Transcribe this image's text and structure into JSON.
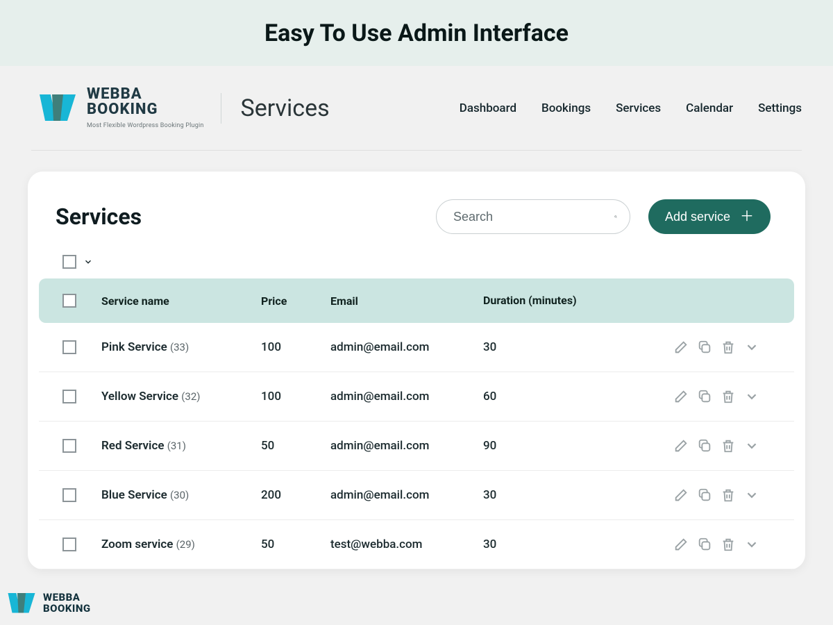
{
  "banner": {
    "title": "Easy To Use Admin Interface"
  },
  "brand": {
    "name1": "WEBBA",
    "name2": "BOOKING",
    "tagline": "Most Flexible Wordpress Booking Plugin"
  },
  "page_title": "Services",
  "nav": [
    "Dashboard",
    "Bookings",
    "Services",
    "Calendar",
    "Settings"
  ],
  "card": {
    "title": "Services",
    "search_placeholder": "Search",
    "add_button": "Add service"
  },
  "columns": {
    "name": "Service name",
    "price": "Price",
    "email": "Email",
    "duration": "Duration (minutes)"
  },
  "rows": [
    {
      "name": "Pink Service",
      "id": "(33)",
      "price": "100",
      "email": "admin@email.com",
      "duration": "30"
    },
    {
      "name": "Yellow Service",
      "id": "(32)",
      "price": "100",
      "email": "admin@email.com",
      "duration": "60"
    },
    {
      "name": "Red Service",
      "id": "(31)",
      "price": "50",
      "email": "admin@email.com",
      "duration": "90"
    },
    {
      "name": "Blue Service",
      "id": "(30)",
      "price": "200",
      "email": "admin@email.com",
      "duration": "30"
    },
    {
      "name": "Zoom service",
      "id": "(29)",
      "price": "50",
      "email": "test@webba.com",
      "duration": "30"
    }
  ]
}
